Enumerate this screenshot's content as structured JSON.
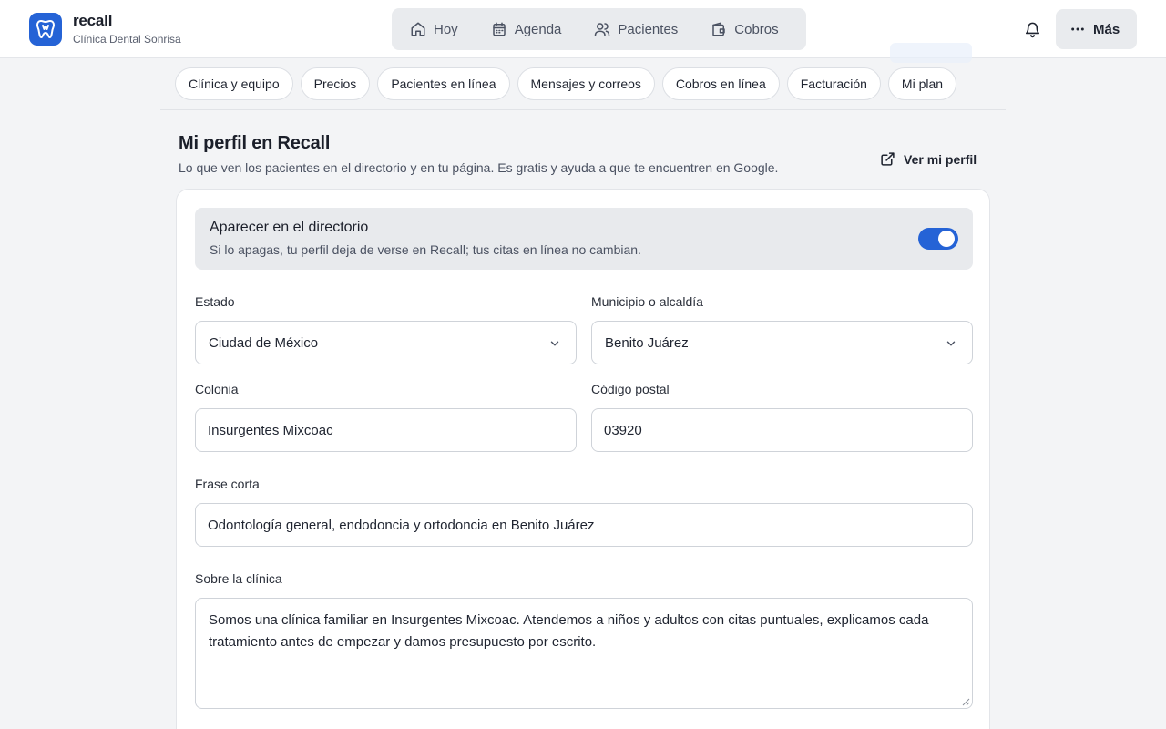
{
  "brand": {
    "name": "recall",
    "clinic": "Clínica Dental Sonrisa",
    "accent": "#2563d6"
  },
  "nav": {
    "items": [
      {
        "label": "Hoy",
        "icon": "home-icon"
      },
      {
        "label": "Agenda",
        "icon": "calendar-icon"
      },
      {
        "label": "Pacientes",
        "icon": "users-icon"
      },
      {
        "label": "Cobros",
        "icon": "wallet-icon"
      }
    ],
    "more_label": "Más"
  },
  "subtabs": [
    "Clínica y equipo",
    "Precios",
    "Pacientes en línea",
    "Mensajes y correos",
    "Cobros en línea",
    "Facturación",
    "Mi plan"
  ],
  "section": {
    "title": "Mi perfil en Recall",
    "subtitle": "Lo que ven los pacientes en el directorio y en tu página. Es gratis y ayuda a que te encuentren en Google.",
    "view_profile_label": "Ver mi perfil"
  },
  "directory": {
    "title": "Aparecer en el directorio",
    "subtitle": "Si lo apagas, tu perfil deja de verse en Recall; tus citas en línea no cambian.",
    "enabled": true
  },
  "form": {
    "state": {
      "label": "Estado",
      "value": "Ciudad de México"
    },
    "municipality": {
      "label": "Municipio o alcaldía",
      "value": "Benito Juárez"
    },
    "colony": {
      "label": "Colonia",
      "value": "Insurgentes Mixcoac"
    },
    "postal_code": {
      "label": "Código postal",
      "value": "03920"
    },
    "tagline": {
      "label": "Frase corta",
      "value": "Odontología general, endodoncia y ortodoncia en Benito Juárez"
    },
    "about": {
      "label": "Sobre la clínica",
      "value": "Somos una clínica familiar en Insurgentes Mixcoac. Atendemos a niños y adultos con citas puntuales, explicamos cada tratamiento antes de empezar y damos presupuesto por escrito."
    }
  }
}
